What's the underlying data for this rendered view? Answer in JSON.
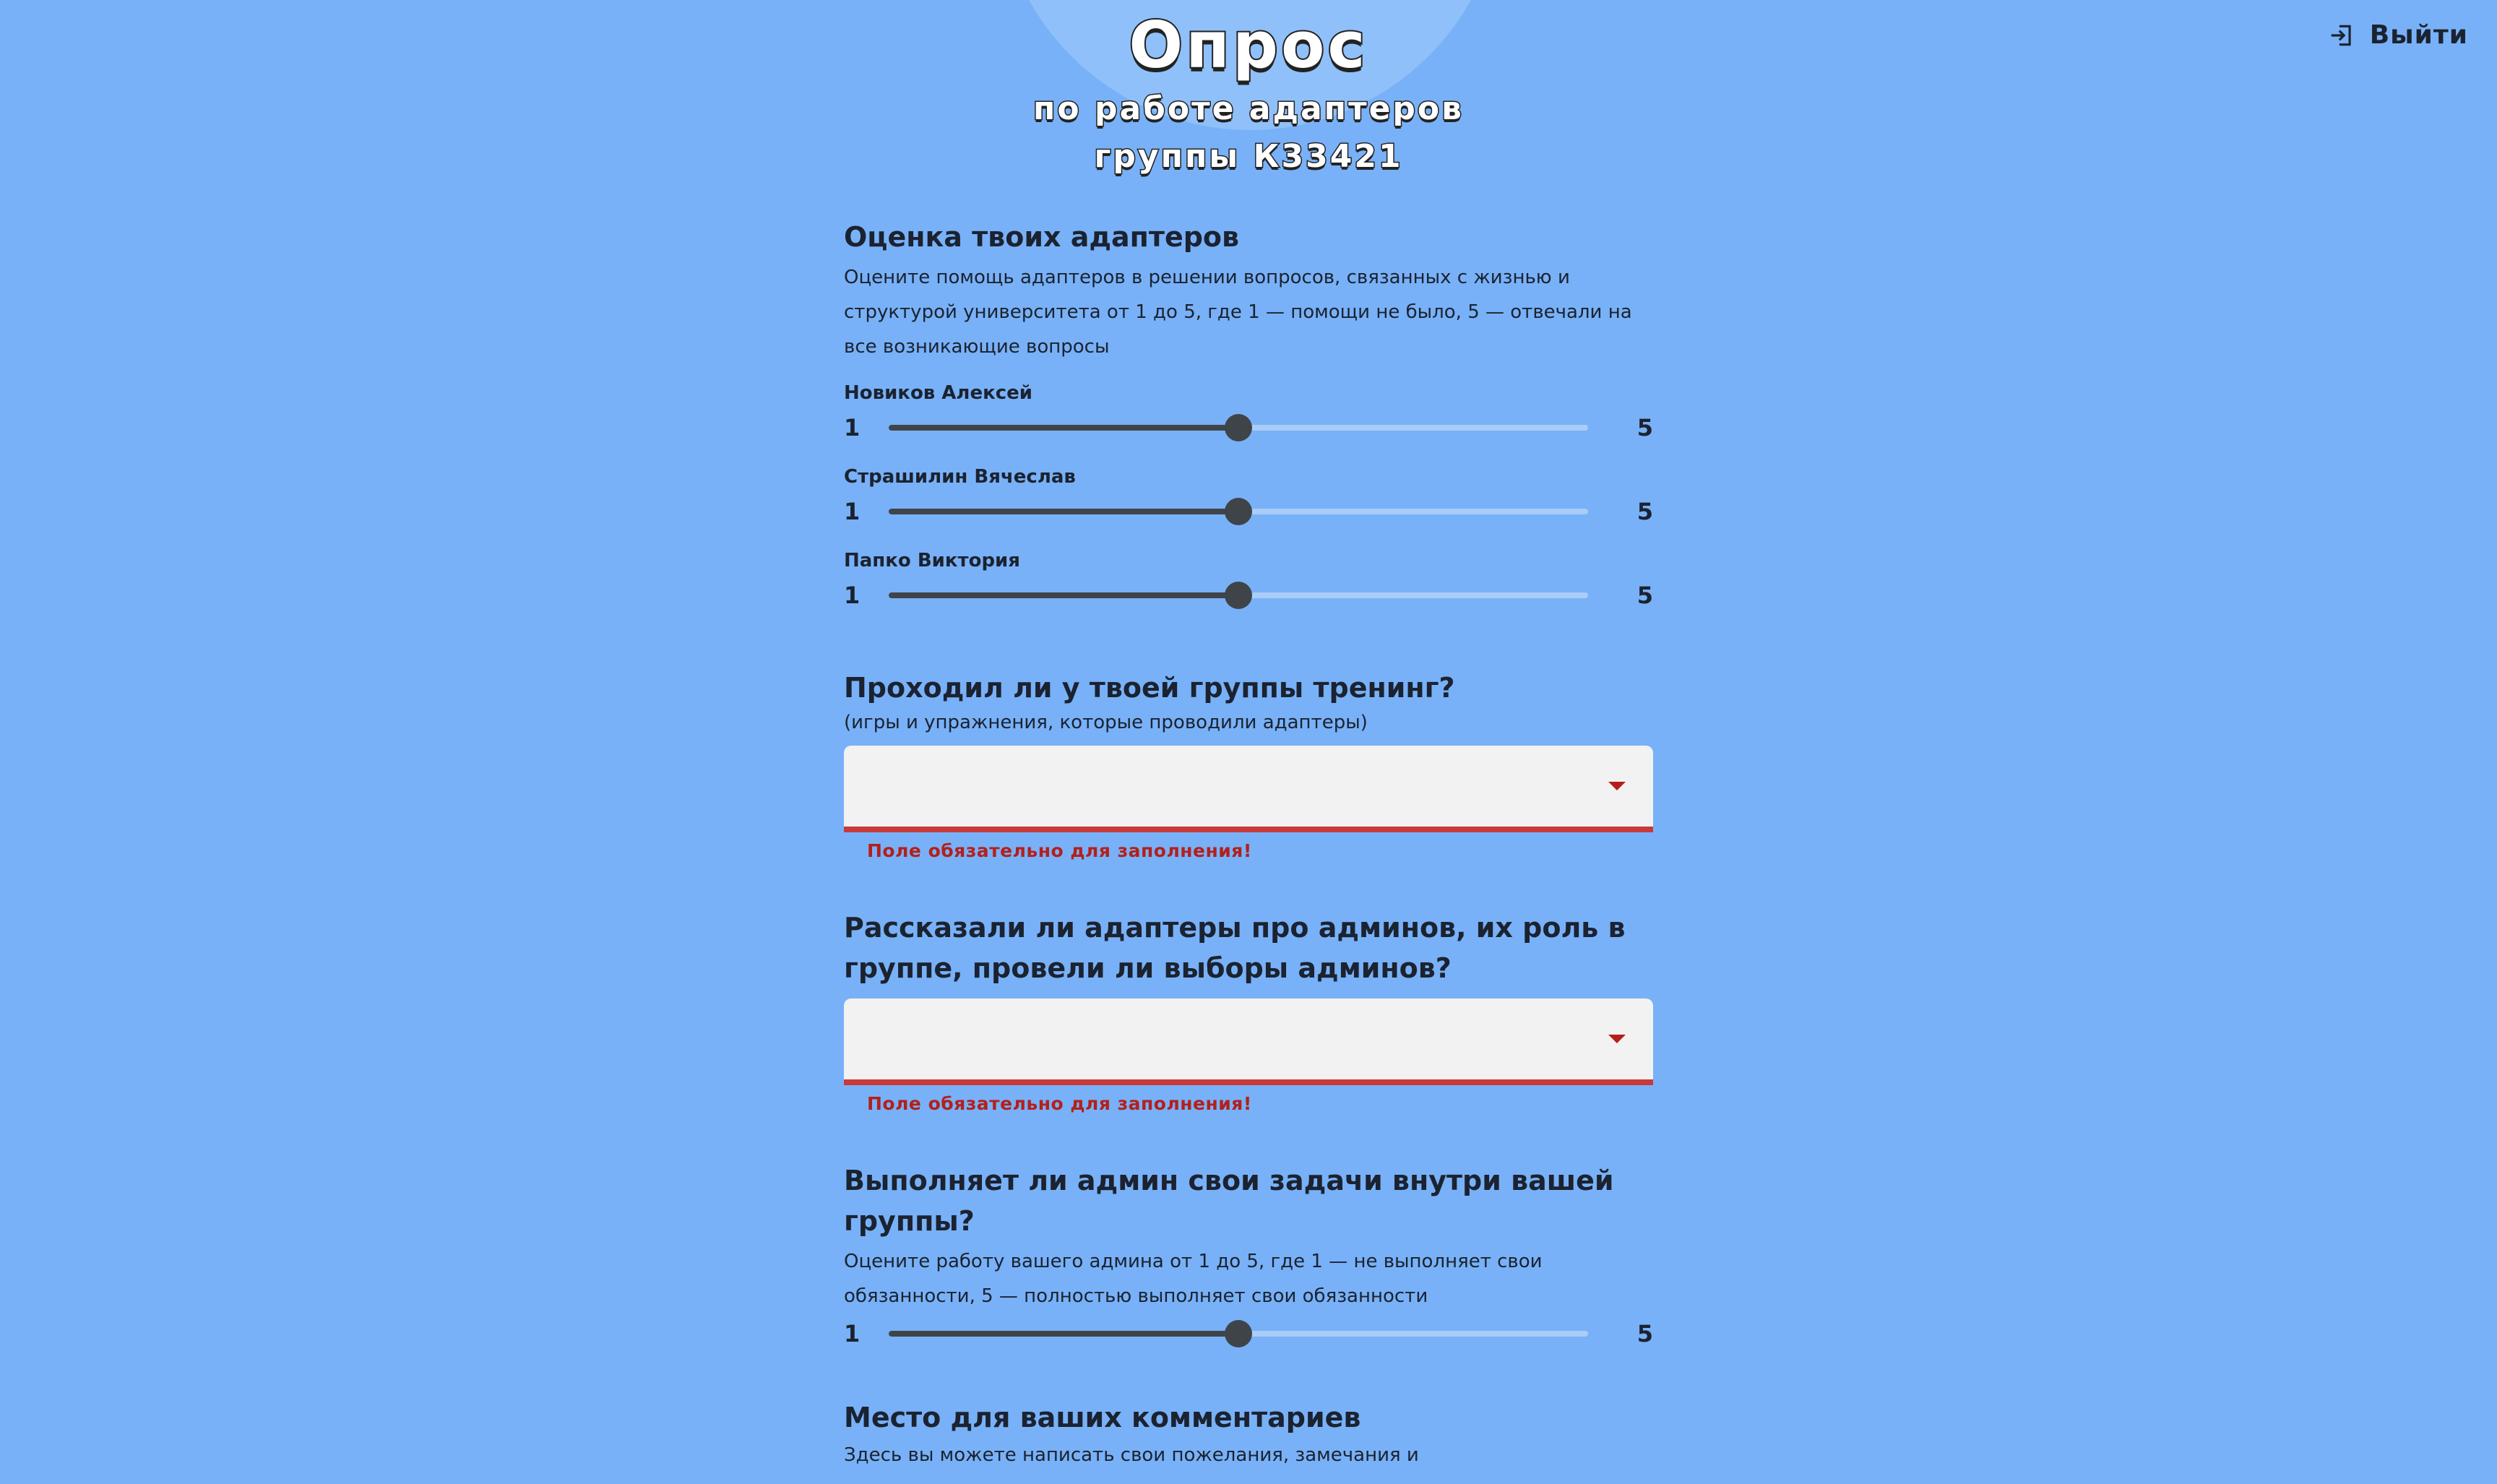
{
  "header": {
    "title": "Опрос",
    "subtitle_line1": "по работе адаптеров",
    "subtitle_line2": "группы К33421",
    "logout_label": "Выйти"
  },
  "rating_section": {
    "title": "Оценка твоих адаптеров",
    "description": "Оцените помощь адаптеров в решении вопросов, связанных с жизнью и структурой университета от 1 до 5, где 1 — помощи не было, 5 — отвечали на все возникающие вопросы",
    "sliders": [
      {
        "label": "Новиков Алексей",
        "min": "1",
        "max": "5",
        "value": 3
      },
      {
        "label": "Страшилин Вячеслав",
        "min": "1",
        "max": "5",
        "value": 3
      },
      {
        "label": "Папко Виктория",
        "min": "1",
        "max": "5",
        "value": 3
      }
    ]
  },
  "training_section": {
    "title": "Проходил ли у твоей группы тренинг?",
    "description": "(игры и упражнения, которые проводили адаптеры)",
    "select_value": "",
    "error": "Поле обязательно для заполнения!"
  },
  "admins_section": {
    "title": "Рассказали ли адаптеры про админов, их роль в группе, провели ли выборы админов?",
    "select_value": "",
    "error": "Поле обязательно для заполнения!"
  },
  "admin_tasks_section": {
    "title": "Выполняет ли админ свои задачи внутри вашей группы?",
    "description": "Оцените работу вашего админа от 1 до 5, где 1 — не выполняет свои обязанности, 5 — полностью выполняет свои обязанности",
    "slider": {
      "min": "1",
      "max": "5",
      "value": 3
    }
  },
  "comments_section": {
    "title": "Место для ваших комментариев",
    "description": "Здесь вы можете написать свои пожелания, замечания и"
  },
  "colors": {
    "background": "#78b1f7",
    "slider": "#3f4449",
    "slider_rail": "#a9cdf6",
    "error": "#b3201c",
    "select_bg": "#f2f2f2"
  }
}
